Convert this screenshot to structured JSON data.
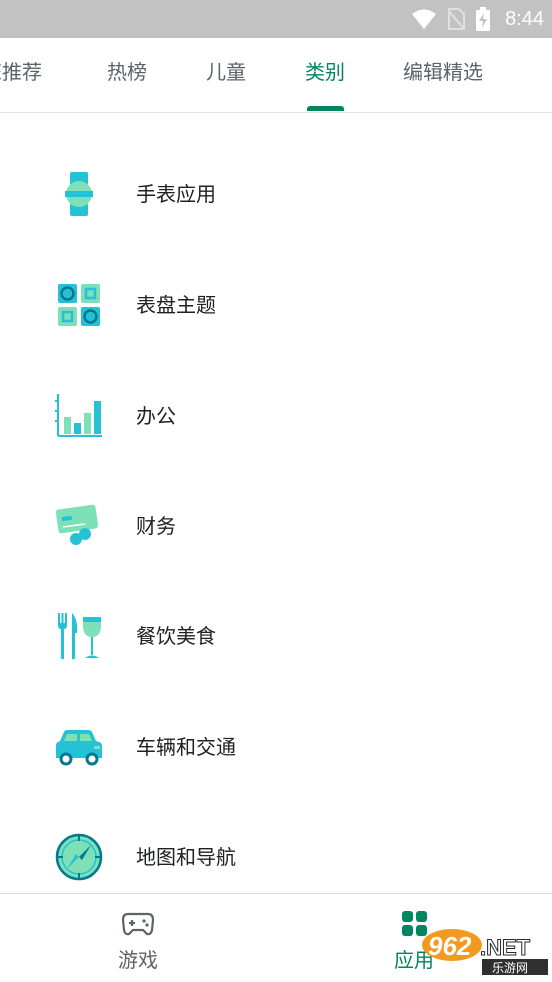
{
  "status_bar": {
    "time": "8:44"
  },
  "tabs": [
    {
      "label": "您推荐",
      "active": false
    },
    {
      "label": "热榜",
      "active": false
    },
    {
      "label": "儿童",
      "active": false
    },
    {
      "label": "类别",
      "active": true
    },
    {
      "label": "编辑精选",
      "active": false
    }
  ],
  "categories": [
    {
      "label": "手表应用",
      "icon": "watch-icon"
    },
    {
      "label": "表盘主题",
      "icon": "watch-face-icon"
    },
    {
      "label": "办公",
      "icon": "office-chart-icon"
    },
    {
      "label": "财务",
      "icon": "finance-card-icon"
    },
    {
      "label": "餐饮美食",
      "icon": "food-drink-icon"
    },
    {
      "label": "车辆和交通",
      "icon": "car-icon"
    },
    {
      "label": "地图和导航",
      "icon": "compass-icon"
    }
  ],
  "bottom_nav": [
    {
      "label": "游戏",
      "icon": "gamepad-icon",
      "active": false
    },
    {
      "label": "应用",
      "icon": "apps-grid-icon",
      "active": true
    }
  ],
  "watermark": {
    "text": "962.NET",
    "subtext": "乐游网"
  },
  "colors": {
    "accent": "#01875f",
    "icon_teal": "#25c2d6",
    "icon_mint": "#7ee0b6",
    "icon_dark": "#01798f"
  }
}
